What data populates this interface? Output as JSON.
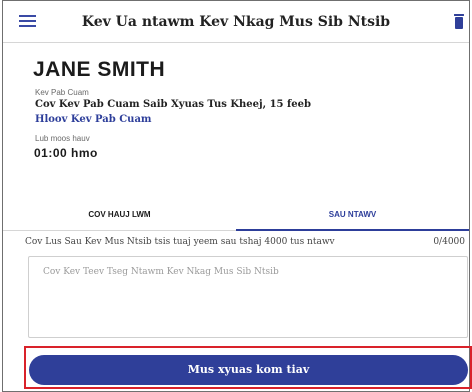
{
  "header": {
    "title": "Kev Ua ntawm Kev Nkag Mus Sib Ntsib",
    "menu_icon": "hamburger-menu-icon",
    "delete_icon": "trash-icon"
  },
  "person": {
    "name": "JANE SMITH"
  },
  "details": {
    "service_label": "Kev Pab Cuam",
    "service_value": "Cov Kev Pab Cuam Saib Xyuas Tus Kheej, 15 feeb",
    "change_link": "Hloov Kev Pab Cuam",
    "time_label": "Lub moos hauv",
    "time_value": "01:00 hmo"
  },
  "tabs": [
    {
      "label": "COV HAUJ LWM",
      "active": false
    },
    {
      "label": "SAU NTAWV",
      "active": true
    }
  ],
  "notes": {
    "hint": "Cov Lus Sau Kev Mus Ntsib tsis tuaj yeem sau tshaj 4000 tus ntawv",
    "count": "0/4000",
    "placeholder": "Cov Kev Teev Tseg Ntawm Kev Nkag Mus Sib Ntsib"
  },
  "actions": {
    "submit_label": "Mus xyuas kom tiav"
  },
  "colors": {
    "primary": "#2f3f99",
    "highlight": "#d9222a"
  }
}
